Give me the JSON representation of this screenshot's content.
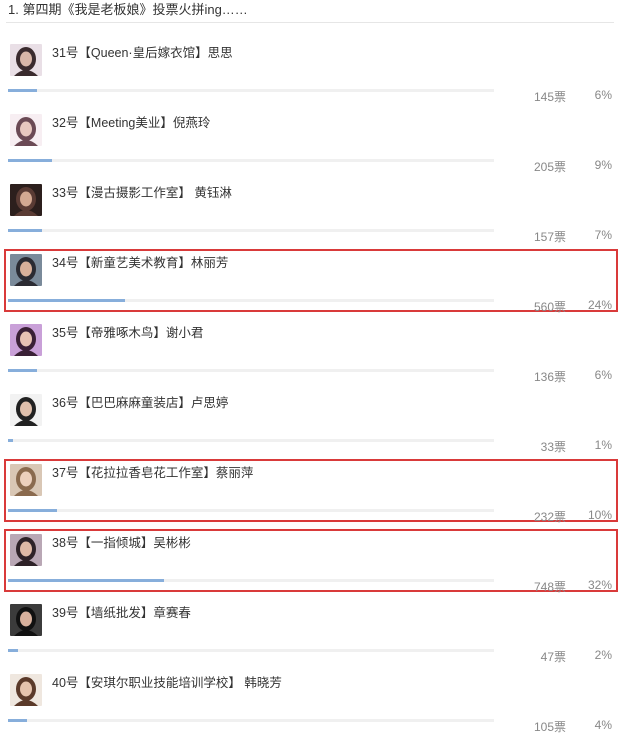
{
  "poll": {
    "title": "1. 第四期《我是老板娘》投票火拼ing……",
    "entries": [
      {
        "name": "31号【Queen·皇后嫁衣馆】思思",
        "votes": "145票",
        "percent": "6%",
        "share": 6,
        "highlighted": false,
        "avatar_icon": "woman-portrait-icon",
        "colors": [
          "#e9dfe6",
          "#3a2b2e",
          "#d8b6a8"
        ]
      },
      {
        "name": "32号【Meeting美业】倪燕玲",
        "votes": "205票",
        "percent": "9%",
        "share": 9,
        "highlighted": false,
        "avatar_icon": "woman-portrait-icon",
        "colors": [
          "#f7eef2",
          "#6b4a55",
          "#e8c8c0"
        ]
      },
      {
        "name": "33号【漫古摄影工作室】 黄钰淋",
        "votes": "157票",
        "percent": "7%",
        "share": 7,
        "highlighted": false,
        "avatar_icon": "woman-portrait-icon",
        "colors": [
          "#2c1f1d",
          "#5a3b34",
          "#d4a992"
        ]
      },
      {
        "name": "34号【新童艺美术教育】林丽芳",
        "votes": "560票",
        "percent": "24%",
        "share": 24,
        "highlighted": true,
        "avatar_icon": "woman-portrait-icon",
        "colors": [
          "#7a8a9a",
          "#2b2b33",
          "#d8b09a"
        ]
      },
      {
        "name": "35号【帝雅啄木鸟】谢小君",
        "votes": "136票",
        "percent": "6%",
        "share": 6,
        "highlighted": false,
        "avatar_icon": "woman-portrait-icon",
        "colors": [
          "#c9a0d8",
          "#3a2036",
          "#e7c2b3"
        ]
      },
      {
        "name": "36号【巴巴麻麻童装店】卢思婷",
        "votes": "33票",
        "percent": "1%",
        "share": 1,
        "highlighted": false,
        "avatar_icon": "woman-portrait-icon",
        "colors": [
          "#f2f2f2",
          "#222222",
          "#e0c0ac"
        ]
      },
      {
        "name": "37号【花拉拉香皂花工作室】蔡丽萍",
        "votes": "232票",
        "percent": "10%",
        "share": 10,
        "highlighted": true,
        "avatar_icon": "woman-portrait-icon",
        "colors": [
          "#d9c7b5",
          "#8a6a4e",
          "#ecd0bd"
        ]
      },
      {
        "name": "38号【一指倾城】吴彬彬",
        "votes": "748票",
        "percent": "32%",
        "share": 32,
        "highlighted": true,
        "avatar_icon": "woman-portrait-icon",
        "colors": [
          "#b9a7b5",
          "#2e2228",
          "#dfb9a6"
        ]
      },
      {
        "name": "39号【墙纸批发】章赛春",
        "votes": "47票",
        "percent": "2%",
        "share": 2,
        "highlighted": false,
        "avatar_icon": "woman-portrait-icon",
        "colors": [
          "#3b3b3b",
          "#111111",
          "#d7b09c"
        ]
      },
      {
        "name": "40号【安琪尔职业技能培训学校】 韩晓芳",
        "votes": "105票",
        "percent": "4%",
        "share": 4,
        "highlighted": false,
        "avatar_icon": "woman-portrait-icon",
        "colors": [
          "#efe7df",
          "#5b3a2a",
          "#e5c3ad"
        ]
      }
    ]
  },
  "colors": {
    "bar_fill": "#87aedb",
    "bar_track": "#f0f0f0",
    "highlight_border": "#d93a3a"
  }
}
